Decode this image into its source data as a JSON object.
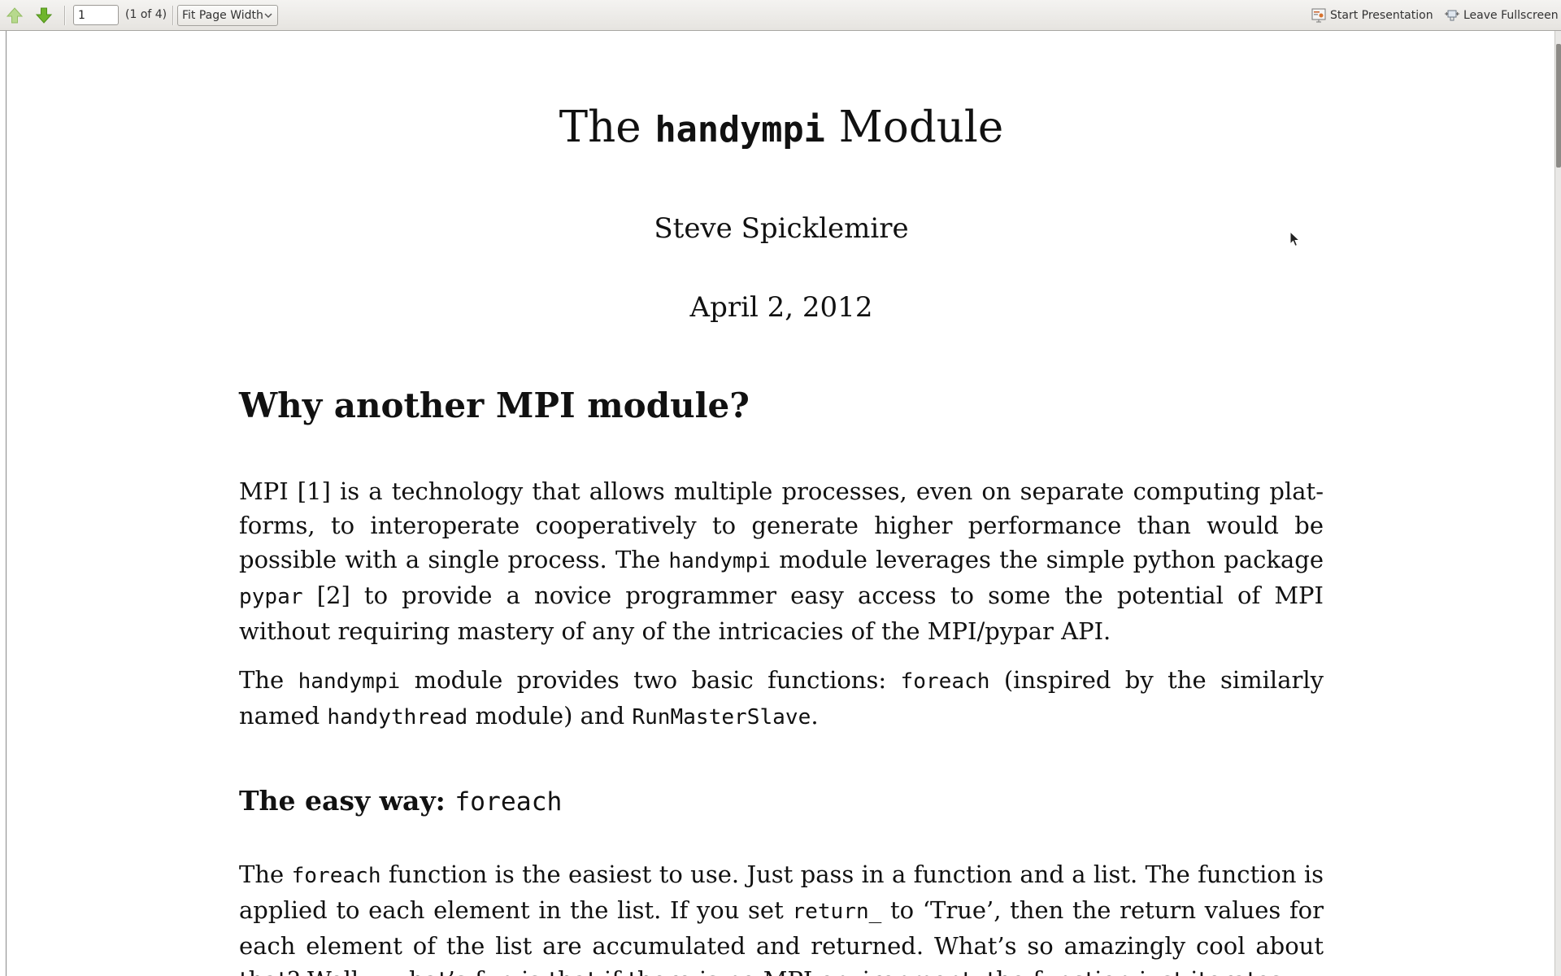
{
  "toolbar": {
    "prev_page_icon": "arrow-up-icon",
    "next_page_icon": "arrow-down-icon",
    "page_number_value": "1",
    "page_count": "(1 of 4)",
    "zoom_value": "Fit Page Width",
    "presentation_label": "Start Presentation",
    "fullscreen_label": "Leave Fullscreen",
    "arrow_color": "#6fb52c"
  },
  "document": {
    "title_pre": "The",
    "title_code": "handympi",
    "title_post": "Module",
    "author": "Steve Spicklemire",
    "date": "April 2, 2012",
    "section_heading": "Why another MPI module?",
    "para1": {
      "t1": "MPI [1] is a technology that allows multiple processes, even on separate computing plat-forms, to interoperate cooperatively to generate higher performance than would be possible with a single process. The",
      "c1": "handympi",
      "t2": "module leverages the simple python package",
      "c2": "pypar",
      "t3": "[2] to provide a novice programmer easy access to some the potential of MPI without requiring mastery of any of the intricacies of the MPI/pypar API."
    },
    "para2": {
      "t1": "The",
      "c1": "handympi",
      "t2": "module provides two basic functions:",
      "c2": "foreach",
      "t3": "(inspired by the similarly named",
      "c3": "handythread",
      "t4": "module) and",
      "c4": "RunMasterSlave",
      "t5": "."
    },
    "subsection_heading_text": "The easy way:",
    "subsection_heading_code": "foreach",
    "para3": {
      "t1": "The",
      "c1": "foreach",
      "t2": "function is the easiest to use. Just pass in a function and a list. The function is applied to each element in the list. If you set",
      "c2": "return_",
      "t3": "to ‘True’, then the return values for each element of the list are accumulated and returned. What’s so amazingly cool about that? Well... what’s fun is that if there is no MPI environment, the function just iterates"
    }
  }
}
